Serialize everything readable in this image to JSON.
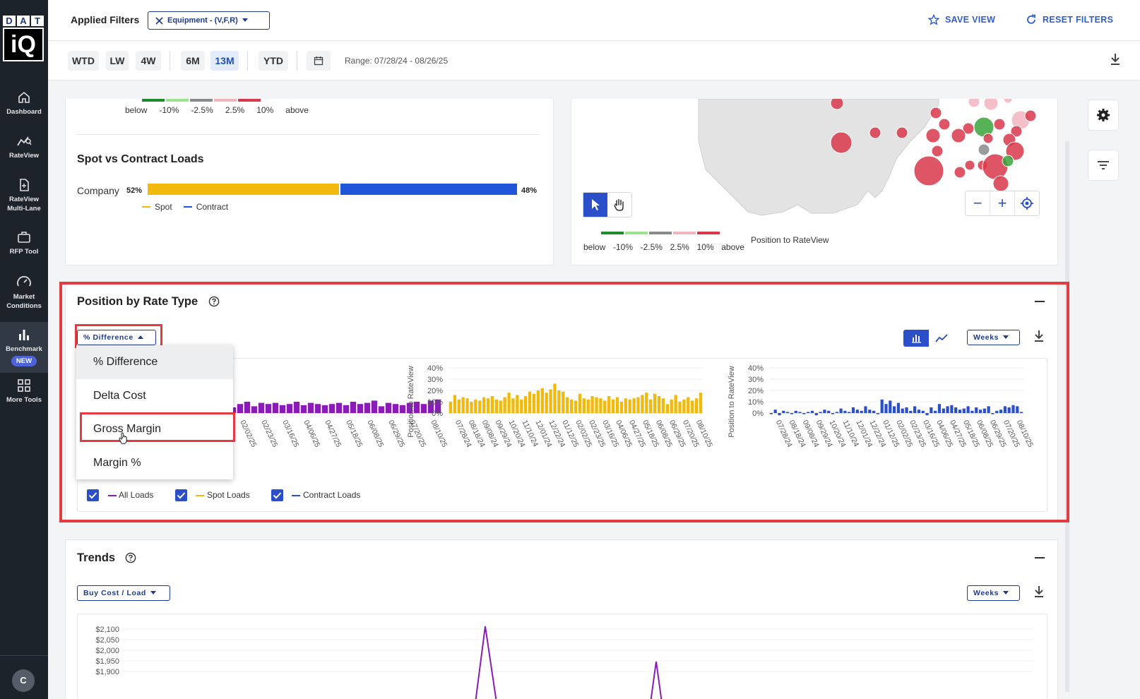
{
  "logo": {
    "letters": [
      "D",
      "A",
      "T"
    ],
    "mark": "iQ"
  },
  "sidebar": {
    "items": [
      {
        "label": "Dashboard",
        "icon": "home-icon"
      },
      {
        "label": "RateView",
        "icon": "rateview-icon"
      },
      {
        "label": "RateView Multi-Lane",
        "icon": "document-icon"
      },
      {
        "label": "RFP Tool",
        "icon": "briefcase-icon"
      },
      {
        "label": "Market Conditions",
        "icon": "gauge-icon"
      },
      {
        "label": "Benchmark",
        "icon": "bar-chart-icon",
        "badge": "NEW",
        "active": true
      },
      {
        "label": "More Tools",
        "icon": "grid-icon"
      }
    ],
    "avatar": "C"
  },
  "header": {
    "applied_filters": "Applied Filters",
    "filter_chip": "Equipment - (V,F,R)",
    "save_view": "SAVE VIEW",
    "reset_filters": "RESET FILTERS"
  },
  "range": {
    "buttons": [
      "WTD",
      "LW",
      "4W",
      "6M",
      "13M",
      "YTD"
    ],
    "active": "13M",
    "range_text": "Range: 07/28/24 - 08/26/25"
  },
  "top_left_card": {
    "legend": [
      "below",
      "-10%",
      "-2.5%",
      "2.5%",
      "10%",
      "above"
    ],
    "legend_colors": [
      "#1e8c2a",
      "#9be38e",
      "#8a8a8a",
      "#f2b4bf",
      "#d8384a"
    ],
    "spot_contract": {
      "title": "Spot vs Contract Loads",
      "row_label": "Company",
      "spot_pct": "52%",
      "contract_pct": "48%",
      "spot_value": 52,
      "contract_value": 48,
      "spot_label": "Spot",
      "contract_label": "Contract",
      "spot_color": "#f0b90b",
      "contract_color": "#1f55d8"
    }
  },
  "map_card": {
    "legend": [
      "below",
      "-10%",
      "-2.5%",
      "2.5%",
      "10%",
      "above"
    ],
    "legend_title": "Position to RateView",
    "zoom_out": "−",
    "zoom_in": "+"
  },
  "position_section": {
    "title": "Position by Rate Type",
    "metric_dropdown": "% Difference",
    "period_dropdown": "Weeks",
    "menu_items": [
      "% Difference",
      "Delta Cost",
      "Gross Margin",
      "Margin %"
    ],
    "menu_selected": "% Difference",
    "menu_highlighted": "Gross Margin",
    "legend": [
      {
        "label": "All Loads",
        "color": "#8a1bb8"
      },
      {
        "label": "Spot Loads",
        "color": "#f0b90b"
      },
      {
        "label": "Contract Loads",
        "color": "#2a4fc9"
      }
    ]
  },
  "trends_section": {
    "title": "Trends",
    "metric_dropdown": "Buy Cost / Load",
    "period_dropdown": "Weeks"
  },
  "chart_data": [
    {
      "type": "bar",
      "title": "",
      "ylabel": "",
      "color": "#8a1bb8",
      "x": [
        "02/02/25",
        "02/23/25",
        "03/16/25",
        "04/06/25",
        "04/27/25",
        "05/18/25",
        "06/08/25",
        "06/29/25",
        "07/20/25",
        "08/10/25"
      ],
      "values": [
        5,
        8,
        10,
        6,
        9,
        8,
        9,
        7,
        8,
        10,
        7,
        9,
        8,
        7,
        8,
        9,
        7,
        10,
        8,
        9,
        11,
        6,
        9,
        8,
        7,
        9,
        10,
        8,
        11,
        12
      ]
    },
    {
      "type": "bar",
      "ylabel": "Position to RateView",
      "ylim": [
        0,
        40
      ],
      "yticks": [
        "40%",
        "30%",
        "20%",
        "10%",
        "0%"
      ],
      "color": "#f0b90b",
      "x": [
        "07/28/24",
        "08/18/24",
        "09/08/24",
        "09/29/24",
        "10/20/24",
        "11/10/24",
        "12/01/24",
        "12/22/24",
        "01/12/25",
        "02/02/25",
        "02/23/25",
        "03/16/25",
        "04/06/25",
        "04/27/25",
        "05/18/25",
        "06/08/25",
        "06/29/25",
        "07/20/25",
        "08/10/25"
      ],
      "values": [
        10,
        16,
        12,
        14,
        13,
        10,
        12,
        11,
        14,
        13,
        15,
        12,
        11,
        14,
        18,
        13,
        16,
        12,
        15,
        19,
        17,
        20,
        22,
        18,
        21,
        26,
        20,
        19,
        14,
        12,
        11,
        17,
        13,
        12,
        15,
        14,
        13,
        11,
        15,
        12,
        14,
        10,
        13,
        12,
        13,
        14,
        16,
        18,
        12,
        17,
        15,
        13,
        8,
        12,
        16,
        10,
        12,
        14,
        11,
        13,
        18
      ]
    },
    {
      "type": "bar",
      "ylabel": "Position to RateView",
      "ylim": [
        0,
        40
      ],
      "yticks": [
        "40%",
        "30%",
        "20%",
        "10%",
        "0%"
      ],
      "color": "#2a4fc9",
      "x": [
        "07/28/24",
        "08/18/24",
        "09/08/24",
        "09/29/24",
        "10/20/24",
        "11/10/24",
        "12/01/24",
        "12/22/24",
        "01/12/25",
        "02/02/25",
        "02/23/25",
        "03/16/25",
        "04/06/25",
        "04/27/25",
        "05/18/25",
        "06/08/25",
        "06/29/25",
        "07/20/25",
        "08/10/25"
      ],
      "values": [
        -1,
        3,
        -2,
        2,
        1,
        -1,
        2,
        1,
        -1,
        1,
        2,
        -2,
        1,
        3,
        2,
        -1,
        1,
        4,
        2,
        1,
        5,
        3,
        2,
        6,
        3,
        2,
        -1,
        12,
        8,
        11,
        6,
        9,
        4,
        5,
        2,
        6,
        3,
        2,
        -2,
        5,
        2,
        8,
        4,
        6,
        7,
        5,
        3,
        4,
        6,
        2,
        5,
        3,
        4,
        6,
        -1,
        2,
        3,
        6,
        5,
        7,
        6,
        1
      ]
    },
    {
      "type": "line",
      "title": "",
      "yticks": [
        "$2,100",
        "$2,050",
        "$2,000",
        "$1,950",
        "$1,900"
      ],
      "color": "#8a1bb8"
    }
  ]
}
